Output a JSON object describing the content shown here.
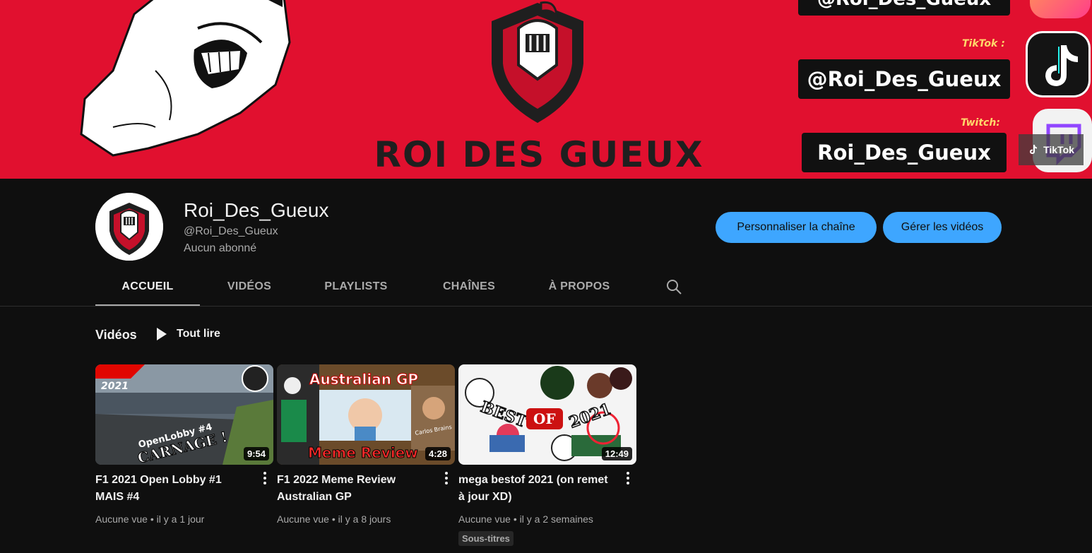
{
  "banner": {
    "title": "ROI DES GUEUX",
    "top_handle": "@Roi_Des_Gueux",
    "tiktok_label": "TikTok :",
    "tiktok_handle": "@Roi_Des_Gueux",
    "twitch_label": "Twitch:",
    "twitch_handle": "Roi_Des_Gueux",
    "tiktok_chip": "TikTok"
  },
  "channel": {
    "name": "Roi_Des_Gueux",
    "handle": "@Roi_Des_Gueux",
    "subscribers": "Aucun abonné",
    "customize_label": "Personnaliser la chaîne",
    "manage_label": "Gérer les vidéos"
  },
  "tabs": [
    {
      "label": "ACCUEIL",
      "active": true
    },
    {
      "label": "VIDÉOS",
      "active": false
    },
    {
      "label": "PLAYLISTS",
      "active": false
    },
    {
      "label": "CHAÎNES",
      "active": false
    },
    {
      "label": "À PROPOS",
      "active": false
    }
  ],
  "section": {
    "title": "Vidéos",
    "play_all": "Tout lire"
  },
  "videos": [
    {
      "title": "F1 2021 Open Lobby #1 MAIS #4",
      "views": "Aucune vue",
      "age": "il y a 1 jour",
      "duration": "9:54",
      "thumb_text_1": "2021",
      "thumb_text_2": "OpenLobby #4",
      "thumb_text_3": "CARNAGE !"
    },
    {
      "title": "F1 2022 Meme Review Australian GP",
      "views": "Aucune vue",
      "age": "il y a 8 jours",
      "duration": "4:28",
      "thumb_text_1": "Australian GP",
      "thumb_text_2": "Meme Review",
      "thumb_text_3": "Carlos Brains"
    },
    {
      "title": "mega bestof 2021 (on remet à jour XD)",
      "views": "Aucune vue",
      "age": "il y a 2 semaines",
      "duration": "12:49",
      "badge": "Sous-titres",
      "thumb_text_1": "BEST",
      "thumb_text_2": "OF",
      "thumb_text_3": "2021"
    }
  ],
  "colors": {
    "banner_red": "#e1102f",
    "accent_blue": "#3ea6ff",
    "background": "#0f0f0f"
  }
}
